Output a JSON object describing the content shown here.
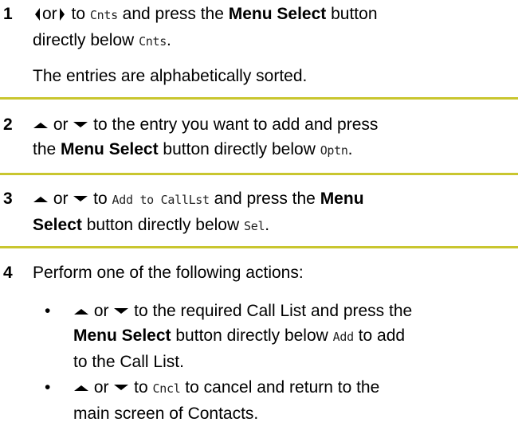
{
  "steps": [
    {
      "number": "1",
      "line1_or": "or",
      "line1_to": " to ",
      "line1_cnts": "Cnts",
      "line1_press": " and press the ",
      "menu_select": "Menu Select",
      "line1_button": " button",
      "line2_a": "directly below ",
      "line2_cnts": "Cnts",
      "line2_end": ".",
      "note": "The entries are alphabetically sorted."
    },
    {
      "number": "2",
      "l1": " or ",
      "l1b": " to the entry you want to add and press",
      "l2a": "the ",
      "menu_select": "Menu Select",
      "l2b": " button directly below ",
      "optn": "Optn",
      "l2c": "."
    },
    {
      "number": "3",
      "l1": " or ",
      "l1b": " to ",
      "addto": "Add to CallLst",
      "l1c": " and press the ",
      "menu": "Menu",
      "select": "Select",
      "l2b": " button directly below ",
      "sel": "Sel",
      "l2c": "."
    },
    {
      "number": "4",
      "intro": "Perform one of the following actions:",
      "bullets": [
        {
          "mark": "•",
          "or": " or ",
          "t1": " to the required Call List and press the",
          "menu_select": "Menu Select",
          "t2": " button directly below ",
          "add": "Add",
          "t3": " to add",
          "t4": "to the Call List."
        },
        {
          "mark": "•",
          "or": " or ",
          "t1": " to ",
          "cncl": "Cncl",
          "t2": " to cancel and return to the",
          "t3": "main screen of Contacts."
        }
      ]
    }
  ],
  "icons": [
    "left-arrow-icon",
    "right-arrow-icon",
    "up-arrow-icon",
    "down-arrow-icon"
  ],
  "rule_color": "#c9c62f"
}
